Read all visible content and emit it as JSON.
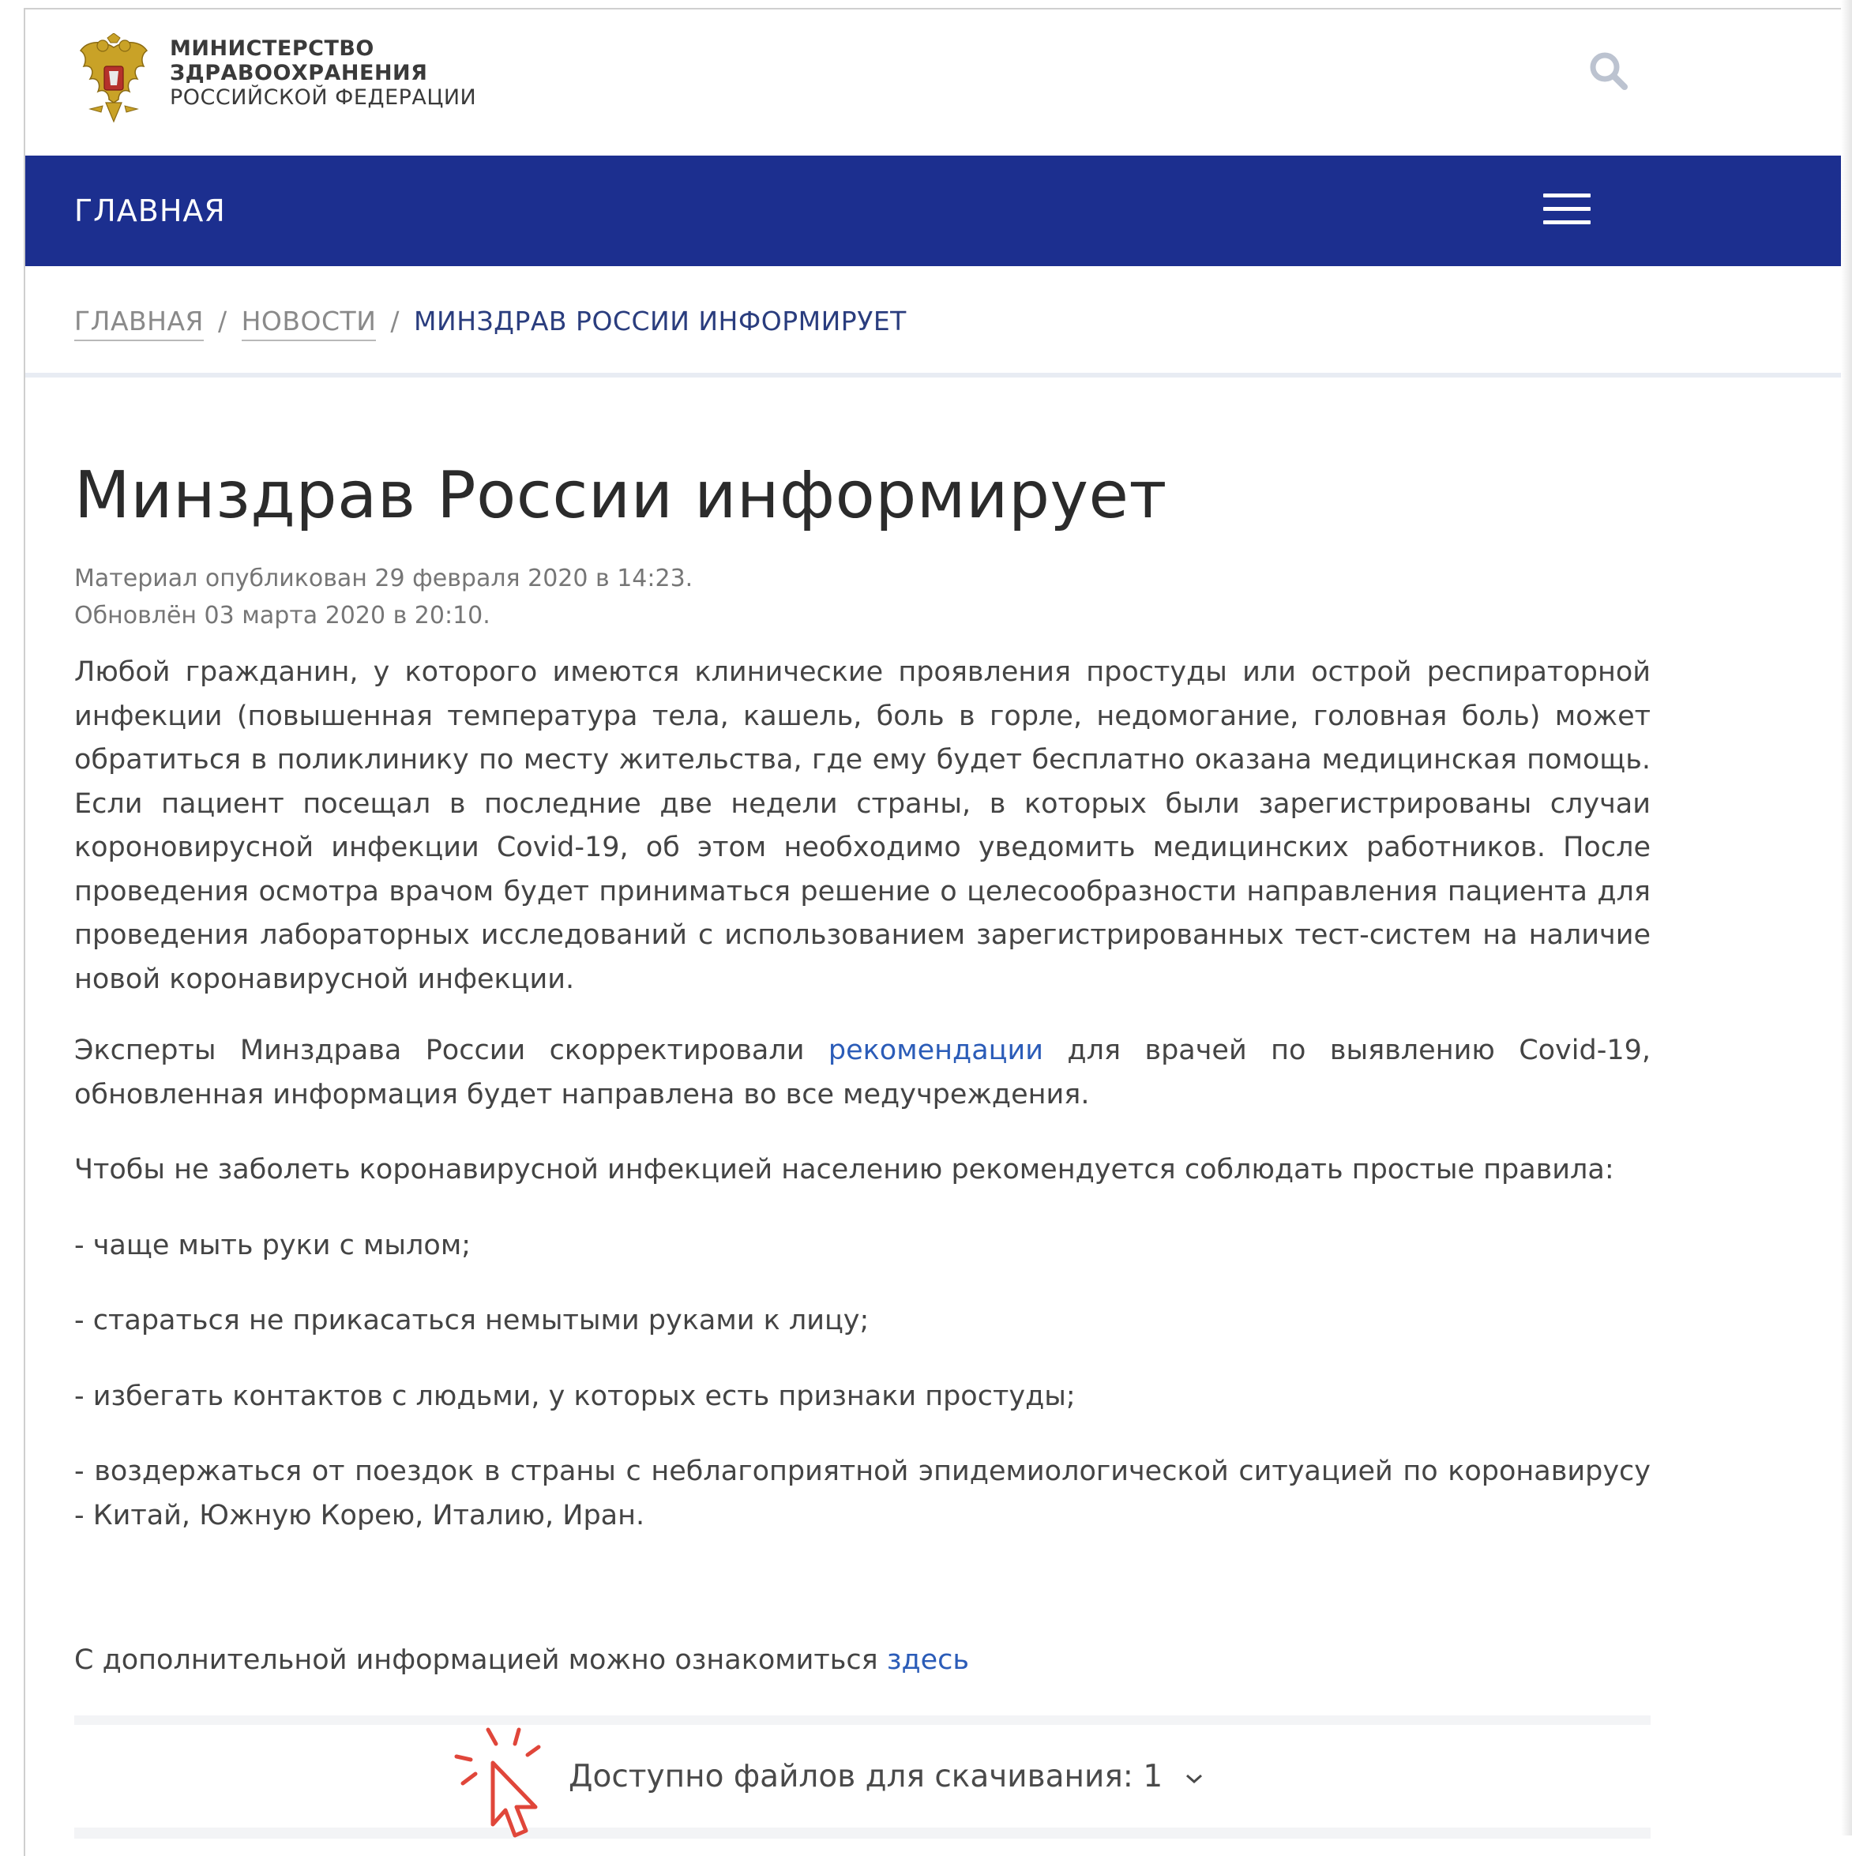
{
  "header": {
    "org_name_line1": "МИНИСТЕРСТВО",
    "org_name_line2": "ЗДРАВООХРАНЕНИЯ",
    "org_name_line3": "РОССИЙСКОЙ ФЕДЕРАЦИИ",
    "search_icon": "search-icon"
  },
  "nav": {
    "home": "ГЛАВНАЯ",
    "menu_icon": "hamburger-menu-icon"
  },
  "breadcrumb": {
    "items": [
      "ГЛАВНАЯ",
      "НОВОСТИ"
    ],
    "separator": "/",
    "current": "МИНЗДРАВ РОССИИ ИНФОРМИРУЕТ"
  },
  "article": {
    "title": "Минздрав России информирует",
    "published": "Материал опубликован 29 февраля 2020 в 14:23.",
    "updated": "Обновлён 03 марта 2020 в 20:10.",
    "paragraph1": "Любой гражданин, у которого имеются клинические проявления простуды или острой респираторной инфекции (повышенная температура тела, кашель, боль в горле, недомогание, головная боль)  может обратиться в поликлинику по месту жительства, где ему будет бесплатно оказана  медицинская помощь. Если пациент посещал в последние две недели страны, в которых были зарегистрированы случаи короновирусной инфекции Covid-19, об этом необходимо уведомить медицинских работников. После проведения осмотра врачом будет приниматься решение о целесообразности направления пациента для проведения лабораторных исследований с использованием зарегистрированных тест-систем на наличие новой коронавирусной инфекции.",
    "paragraph2_before": "Эксперты Минздрава России скорректировали ",
    "paragraph2_link": "рекомендации",
    "paragraph2_after": " для врачей по выявлению Covid-19, обновленная информация будет направлена во все медучреждения.",
    "paragraph3": "Чтобы не заболеть коронавирусной инфекцией населению рекомендуется соблюдать простые правила:",
    "rules": [
      "- чаще мыть руки с мылом;",
      "- стараться не прикасаться немытыми руками к лицу;",
      "- избегать контактов с людьми, у которых есть признаки простуды;",
      "- воздержаться от поездок в страны с неблагоприятной эпидемиологической ситуацией по коронавирусу - Китай, Южную Корею, Италию, Иран."
    ],
    "extra_before": "С дополнительной информацией можно ознакомиться ",
    "extra_link": "здесь"
  },
  "downloads": {
    "label": "Доступно файлов для скачивания: 1",
    "chevron_icon": "chevron-down-icon"
  },
  "colors": {
    "nav_background": "#1c2f8f",
    "link": "#2b5cb8",
    "cursor_accent": "#e0463a"
  }
}
